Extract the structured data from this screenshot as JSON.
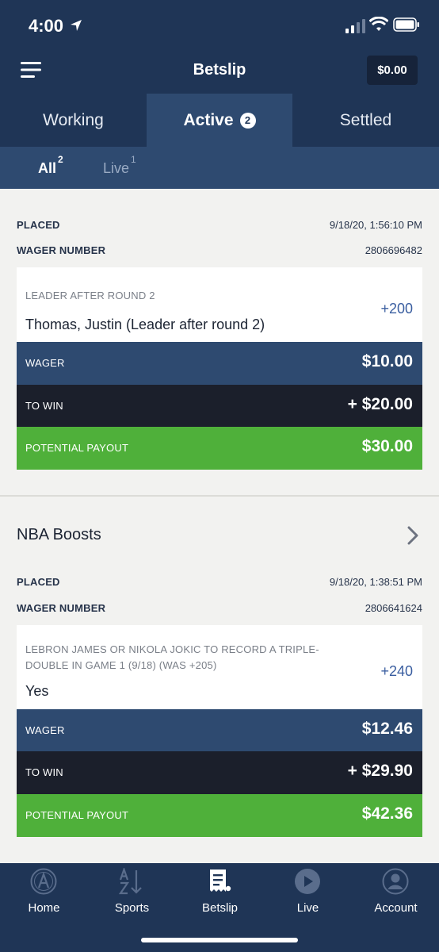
{
  "status": {
    "time": "4:00"
  },
  "header": {
    "title": "Betslip",
    "balance": "$0.00"
  },
  "tabs": [
    {
      "label": "Working"
    },
    {
      "label": "Active",
      "count": "2"
    },
    {
      "label": "Settled"
    }
  ],
  "subtabs": [
    {
      "label": "All",
      "count": "2"
    },
    {
      "label": "Live",
      "count": "1"
    }
  ],
  "labels": {
    "placed": "PLACED",
    "wager_number": "WAGER NUMBER",
    "wager": "WAGER",
    "to_win": "TO WIN",
    "potential_payout": "POTENTIAL PAYOUT"
  },
  "bets": [
    {
      "placed": "9/18/20, 1:56:10 PM",
      "wager_number": "2806696482",
      "market": "LEADER AFTER ROUND 2",
      "selection": "Thomas, Justin (Leader after round 2)",
      "odds": "+200",
      "wager": "$10.00",
      "to_win": "+ $20.00",
      "payout": "$30.00"
    },
    {
      "section_title": "NBA Boosts",
      "placed": "9/18/20, 1:38:51 PM",
      "wager_number": "2806641624",
      "market_line1": "LEBRON JAMES OR NIKOLA JOKIC TO RECORD A TRIPLE-",
      "market_line2": "DOUBLE IN GAME 1 (9/18) (WAS +205)",
      "selection": "Yes",
      "odds": "+240",
      "wager": "$12.46",
      "to_win": "+ $29.90",
      "payout": "$42.36"
    }
  ],
  "nav": [
    {
      "label": "Home",
      "icon": "barstool-logo-icon"
    },
    {
      "label": "Sports",
      "icon": "a-z-sort-icon"
    },
    {
      "label": "Betslip",
      "icon": "betslip-icon"
    },
    {
      "label": "Live",
      "icon": "play-icon"
    },
    {
      "label": "Account",
      "icon": "account-icon"
    }
  ],
  "colors": {
    "header_bg": "#1f3556",
    "active_tab_bg": "#2e4a70",
    "to_win_bg": "#1b1f2b",
    "payout_green": "#4fb03a",
    "odds_blue": "#3a5ea0"
  }
}
